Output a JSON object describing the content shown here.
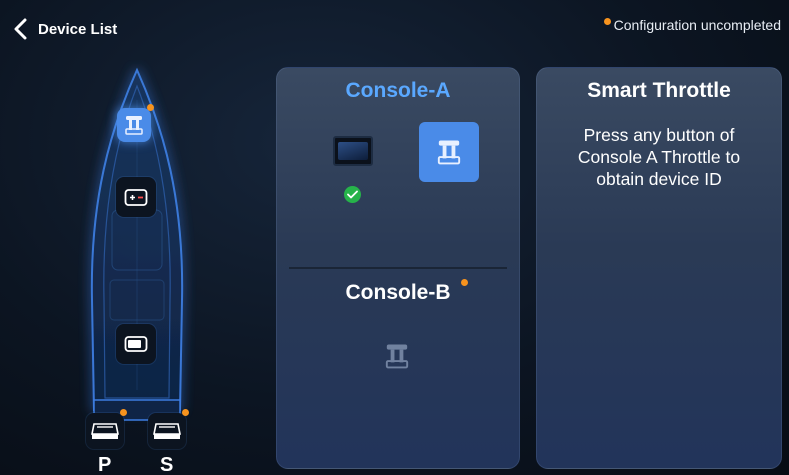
{
  "header": {
    "back_label": "Device List",
    "status_text": "Configuration uncompleted",
    "status_color": "#f7931e"
  },
  "boat": {
    "devices": [
      {
        "name": "throttle",
        "icon": "throttle-icon",
        "active": true,
        "pending": true
      },
      {
        "name": "battery-monitor",
        "icon": "battery-plus-minus-icon",
        "active": false,
        "pending": false
      },
      {
        "name": "display",
        "icon": "display-icon",
        "active": false,
        "pending": false
      },
      {
        "name": "port-engine",
        "icon": "outboard-engine-icon",
        "active": false,
        "pending": true
      },
      {
        "name": "starboard-engine",
        "icon": "outboard-engine-icon",
        "active": false,
        "pending": true
      }
    ],
    "port_label": "P",
    "starboard_label": "S"
  },
  "console_panel": {
    "console_a_title": "Console-A",
    "console_a_title_color": "#5aa8ff",
    "console_b_title": "Console-B"
  },
  "smart_panel": {
    "title": "Smart Throttle",
    "message": "Press any button of Console A Throttle to obtain device ID"
  },
  "colors": {
    "accent": "#4a8be8",
    "success": "#26b34a",
    "pending": "#f7931e"
  }
}
